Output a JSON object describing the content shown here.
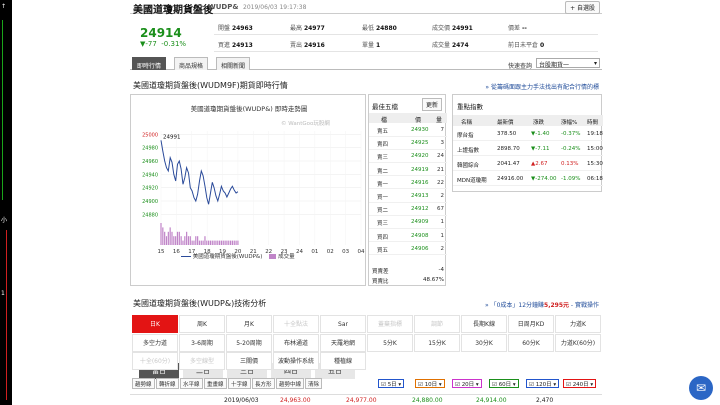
{
  "left_strip": {
    "markers": [
      "↑",
      "小",
      "1"
    ]
  },
  "header": {
    "name": "美國道瓊期貨盤後",
    "code": "WUDP&",
    "datetime": "2019/06/03 19:17:38",
    "fav_label": "+ 自選股"
  },
  "quote": {
    "price": "24914",
    "change": "▼-77",
    "change_pct": "-0.31%",
    "row1": [
      {
        "label": "開盤",
        "value": "24963"
      },
      {
        "label": "最高",
        "value": "24977"
      },
      {
        "label": "最低",
        "value": "24880"
      },
      {
        "label": "成交價",
        "value": "24991"
      },
      {
        "label": "價差",
        "value": "--"
      }
    ],
    "row2": [
      {
        "label": "買進",
        "value": "24913"
      },
      {
        "label": "賣出",
        "value": "24916"
      },
      {
        "label": "單量",
        "value": "1"
      },
      {
        "label": "成交量",
        "value": "2474"
      },
      {
        "label": "前日未平倉",
        "value": "0"
      }
    ]
  },
  "tabs": [
    "即時行情",
    "商品規格",
    "相關新聞"
  ],
  "quick_label": "快速查詢",
  "quick_select": "台股期貨一",
  "section": {
    "title": "美國道瓊期貨盤後(WUDM9F)期貨即時行情",
    "link": "» 從籌碼面跟主力手法找出有配合行情的標"
  },
  "chart": {
    "title": "美國道瓊期貨盤後(WUDP&) 即時走勢圖",
    "watermark": "© WantGoo玩股網",
    "last_label": "24991",
    "legend_line": "美國道瓊期貨盤後(WUDP&)",
    "legend_vol": "成交量",
    "periods": [
      "當日",
      "二日",
      "三日",
      "四日",
      "五日"
    ]
  },
  "chart_data": {
    "type": "line",
    "x_ticks": [
      "15",
      "16",
      "17",
      "18",
      "19",
      "20",
      "21",
      "22",
      "23",
      "24",
      "01",
      "02",
      "03",
      "04"
    ],
    "y_ticks": [
      25000,
      24980,
      24960,
      24940,
      24920,
      24900,
      24880
    ],
    "ylim": [
      24870,
      25005
    ],
    "x_start": 15,
    "x_end": 20,
    "y": [
      24991,
      24975,
      24960,
      24950,
      24945,
      24965,
      24958,
      24940,
      24930,
      24955,
      24960,
      24948,
      24925,
      24935,
      24950,
      24942,
      24920,
      24915,
      24905,
      24900,
      24910,
      24930,
      24945,
      24938,
      24922,
      24905,
      24895,
      24912,
      24928,
      24920,
      24908,
      24900,
      24910,
      24922,
      24915,
      24912,
      24906,
      24912,
      24918,
      24922,
      24916,
      24912,
      24914
    ],
    "volume": [
      5,
      4,
      3,
      2,
      3,
      4,
      3,
      2,
      2,
      3,
      3,
      2,
      1,
      2,
      3,
      2,
      2,
      1,
      1,
      2,
      2,
      1,
      1,
      1,
      2,
      1,
      1,
      1,
      1,
      1,
      1,
      1,
      1,
      1,
      1,
      1,
      1,
      1,
      1,
      1,
      1,
      1,
      1
    ],
    "legend": [
      "美國道瓊期貨盤後(WUDP&)",
      "成交量"
    ]
  },
  "best5": {
    "title": "最佳五檔",
    "update_label": "更新",
    "headers": [
      "檔",
      "價",
      "量"
    ],
    "rows": [
      {
        "label": "賣五",
        "price": "24930",
        "vol": "7"
      },
      {
        "label": "賣四",
        "price": "24925",
        "vol": "3"
      },
      {
        "label": "賣三",
        "price": "24920",
        "vol": "24"
      },
      {
        "label": "賣二",
        "price": "24919",
        "vol": "21"
      },
      {
        "label": "賣一",
        "price": "24916",
        "vol": "22"
      },
      {
        "label": "買一",
        "price": "24913",
        "vol": "2"
      },
      {
        "label": "買二",
        "price": "24912",
        "vol": "67"
      },
      {
        "label": "買三",
        "price": "24909",
        "vol": "1"
      },
      {
        "label": "買四",
        "price": "24908",
        "vol": "1"
      },
      {
        "label": "買五",
        "price": "24906",
        "vol": "2"
      }
    ],
    "footer": [
      {
        "label": "買賣差",
        "value": "-4"
      },
      {
        "label": "買賣比",
        "value": "48.67%"
      }
    ]
  },
  "indices": {
    "title": "重點指數",
    "headers": [
      "名稱",
      "最新價",
      "漲跌",
      "漲幅%",
      "時間"
    ],
    "rows": [
      {
        "name": "摩台指",
        "price": "378.50",
        "chg": "▼-1.40",
        "pct": "-0.37%",
        "time": "19:18",
        "dir": "down"
      },
      {
        "name": "上證指數",
        "price": "2898.70",
        "chg": "▼-7.11",
        "pct": "-0.24%",
        "time": "15:00",
        "dir": "down"
      },
      {
        "name": "韓國綜合",
        "price": "2041.47",
        "chg": "▲2.67",
        "pct": "0.13%",
        "time": "15:30",
        "dir": "up"
      },
      {
        "name": "MDN道瓊期",
        "price": "24916.00",
        "chg": "▼-274.00",
        "pct": "-1.09%",
        "time": "06:18",
        "dir": "down"
      }
    ]
  },
  "tech": {
    "title": "美國道瓊期貨盤後(WUDP&)技術分析",
    "link_prefix": "» 「0成本」12分鐘賺",
    "link_amount": "5,295元",
    "link_suffix": " - 實戰操作",
    "row1": [
      {
        "label": "日K",
        "state": "active"
      },
      {
        "label": "周K",
        "state": ""
      },
      {
        "label": "月K",
        "state": ""
      },
      {
        "label": "十全點法",
        "state": "dim"
      },
      {
        "label": "Sar",
        "state": ""
      },
      {
        "label": "蓋棄指標",
        "state": "dim"
      },
      {
        "label": "調節",
        "state": "dim"
      },
      {
        "label": "長期K線",
        "state": ""
      },
      {
        "label": "日周月KD",
        "state": ""
      },
      {
        "label": "力道K",
        "state": ""
      }
    ],
    "row2": [
      {
        "label": "多空力道",
        "state": ""
      },
      {
        "label": "3-6周期",
        "state": ""
      },
      {
        "label": "5-20周期",
        "state": ""
      },
      {
        "label": "布林通道",
        "state": ""
      },
      {
        "label": "天羅地網",
        "state": ""
      },
      {
        "label": "5分K",
        "state": ""
      },
      {
        "label": "15分K",
        "state": ""
      },
      {
        "label": "30分K",
        "state": ""
      },
      {
        "label": "60分K",
        "state": ""
      },
      {
        "label": "力道K(60分)",
        "state": ""
      }
    ],
    "row3": [
      {
        "label": "十全(60分)",
        "state": "dim"
      },
      {
        "label": "多空線型",
        "state": "dim"
      },
      {
        "label": "三關價",
        "state": ""
      },
      {
        "label": "波動操作系統",
        "state": ""
      },
      {
        "label": "種植線",
        "state": ""
      }
    ]
  },
  "toolbar": {
    "buttons": [
      "趨勢線",
      "轉折線",
      "水平線",
      "重畫線",
      "十字線",
      "長方形",
      "趨勢中線",
      "清除"
    ],
    "ma": [
      {
        "label": "5日",
        "color": "#2255cc"
      },
      {
        "label": "10日",
        "color": "#e07000"
      },
      {
        "label": "20日",
        "color": "#cc33cc"
      },
      {
        "label": "60日",
        "color": "#1b8f1b"
      },
      {
        "label": "120日",
        "color": "#2255cc"
      },
      {
        "label": "240日",
        "color": "#e31414"
      }
    ]
  },
  "bottom": {
    "date": "2019/06/03",
    "o": "24,963.00",
    "h": "24,977.00",
    "l": "24,880.00",
    "c": "24,914.00",
    "v": "2,470"
  }
}
